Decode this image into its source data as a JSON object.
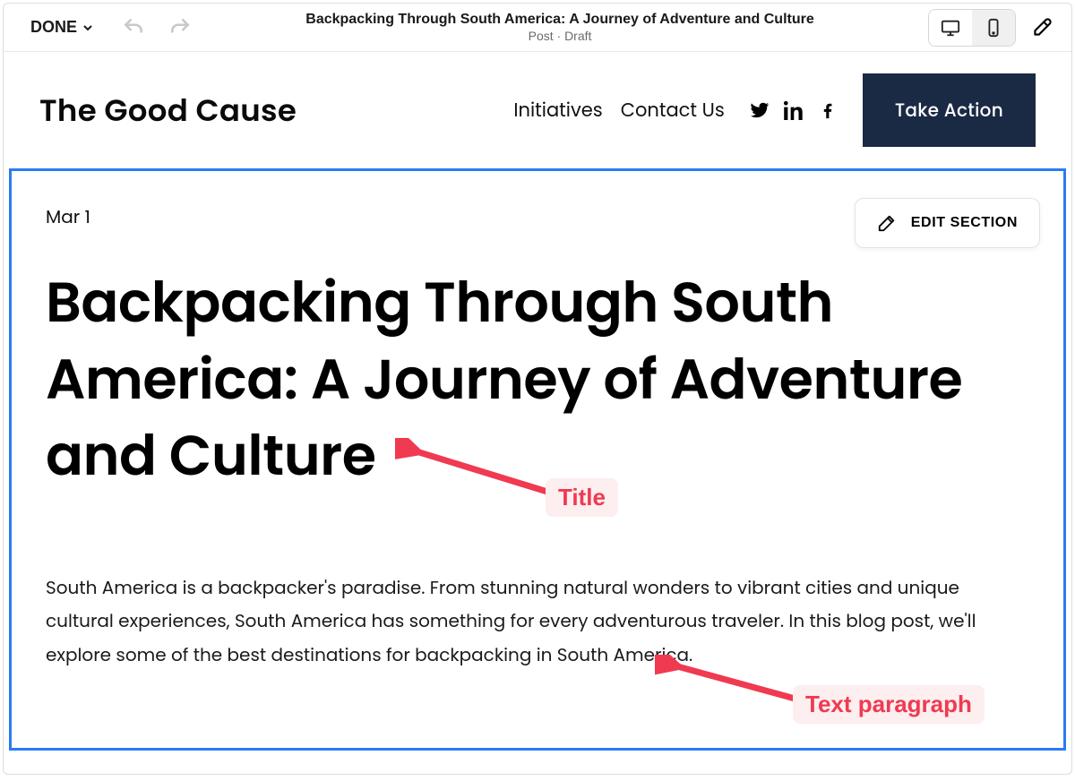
{
  "topbar": {
    "done_label": "DONE",
    "title": "Backpacking Through South America: A Journey of Adventure and Culture",
    "subtitle": "Post · Draft"
  },
  "siteHeader": {
    "brand": "The Good Cause",
    "nav": {
      "initiatives": "Initiatives",
      "contact": "Contact Us"
    },
    "cta": "Take Action"
  },
  "section": {
    "date": "Mar 1",
    "edit_label": "EDIT SECTION",
    "post_title": "Backpacking Through South America: A Journey of Adventure and Culture",
    "post_body": "South America is a backpacker's paradise. From stunning natural wonders to vibrant cities and unique cultural experiences, South America has something for every adventurous traveler. In this blog post, we'll explore some of the best destinations for backpacking in South America."
  },
  "annotations": {
    "title_label": "Title",
    "paragraph_label": "Text paragraph"
  }
}
